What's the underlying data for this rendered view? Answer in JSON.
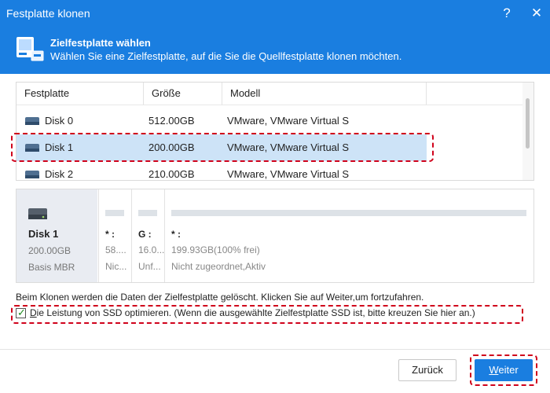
{
  "window": {
    "title": "Festplatte klonen",
    "help_icon": "?",
    "close_icon": "✕"
  },
  "header": {
    "icon": "disk-clone-icon",
    "title": "Zielfestplatte wählen",
    "subtitle": "Wählen Sie eine Zielfestplatte, auf die Sie die Quellfestplatte klonen möchten."
  },
  "disk_table": {
    "columns": [
      "Festplatte",
      "Größe",
      "Modell",
      ""
    ],
    "rows": [
      {
        "name": "Disk 0",
        "size": "512.00GB",
        "model": "VMware, VMware Virtual S",
        "selected": false
      },
      {
        "name": "Disk 1",
        "size": "200.00GB",
        "model": "VMware, VMware Virtual S",
        "selected": true
      },
      {
        "name": "Disk 2",
        "size": "210.00GB",
        "model": "VMware, VMware Virtual S",
        "selected": false
      }
    ]
  },
  "disk_map": {
    "name": "Disk 1",
    "size": "200.00GB",
    "type": "Basis MBR",
    "partitions": [
      {
        "letter": "* :",
        "capacity": "58....",
        "fs": "Nic..."
      },
      {
        "letter": "G :",
        "capacity": "16.0...",
        "fs": "Unf..."
      },
      {
        "letter": "* :",
        "capacity": "199.93GB(100% frei)",
        "fs": "Nicht zugeordnet,Aktiv"
      }
    ]
  },
  "notice": "Beim Klonen werden die Daten der Zielfestplatte gelöscht. Klicken Sie auf Weiter,um fortzufahren.",
  "ssd_option": {
    "checked": true,
    "mark": "✓",
    "label_underlined": "D",
    "label_rest": "ie Leistung von SSD optimieren. (Wenn die ausgewählte Zielfestplatte SSD ist, bitte kreuzen Sie hier an.)"
  },
  "buttons": {
    "back": "Zurück",
    "next_underlined": "W",
    "next_rest": "eiter"
  },
  "colors": {
    "accent": "#1a7ee0",
    "selected_row": "#cde3f7",
    "highlight_dash": "#d0021b"
  }
}
